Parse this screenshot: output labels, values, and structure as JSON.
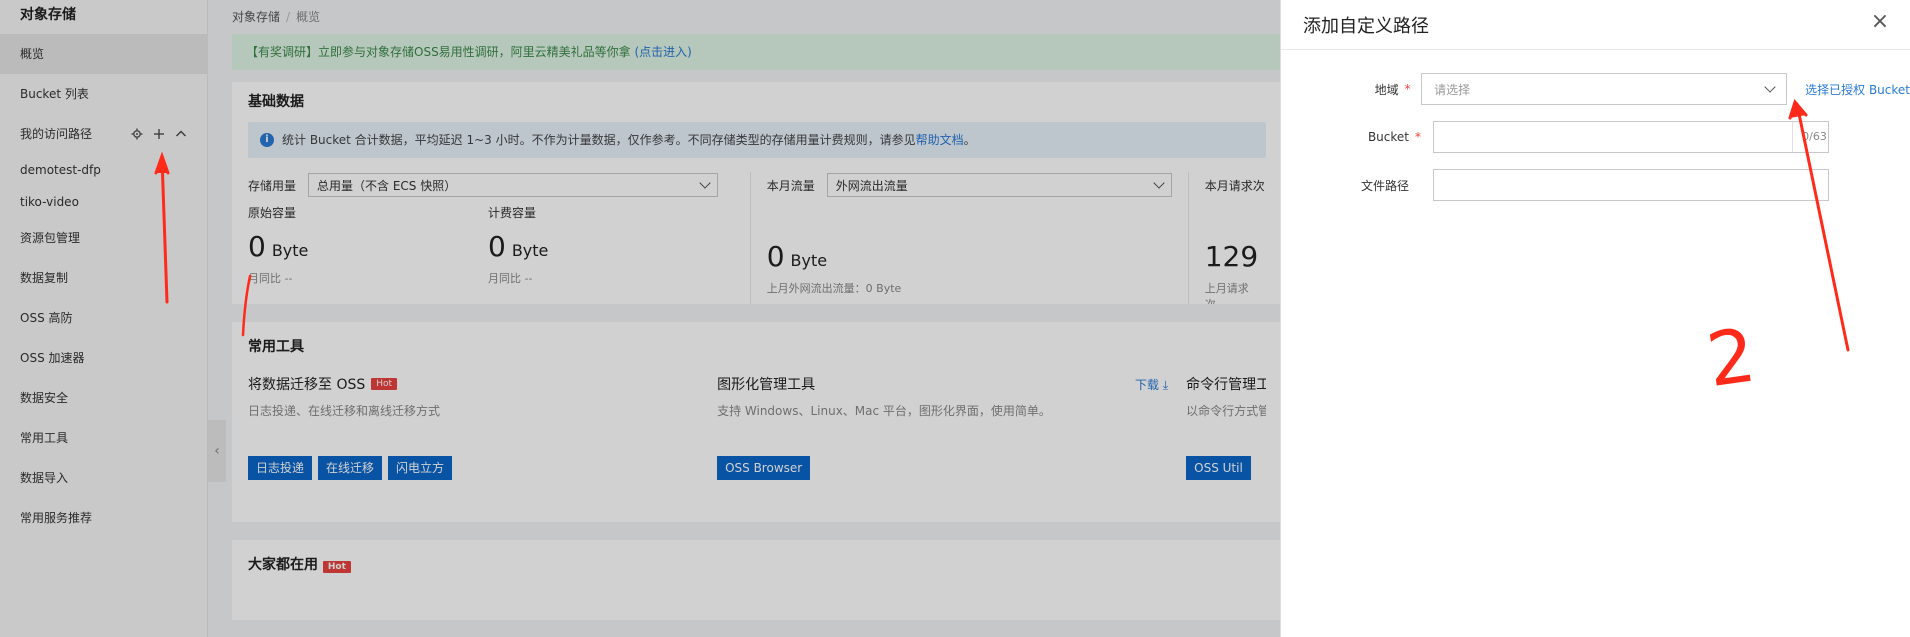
{
  "sidebar": {
    "title": "对象存储",
    "items": [
      {
        "label": "概览",
        "active": true
      },
      {
        "label": "Bucket 列表"
      }
    ],
    "group": {
      "label": "我的访问路径",
      "children": [
        "demotest-dfp",
        "tiko-video"
      ]
    },
    "more_items": [
      "资源包管理",
      "数据复制",
      "OSS 高防",
      "OSS 加速器",
      "数据安全",
      "常用工具",
      "数据导入",
      "常用服务推荐"
    ],
    "collapse_icon": "‹"
  },
  "breadcrumb": {
    "root": "对象存储",
    "sep": "/",
    "current": "概览"
  },
  "notice": {
    "text": "【有奖调研】立即参与对象存储OSS易用性调研，阿里云精美礼品等你拿 ",
    "link": "(点击进入)"
  },
  "basic": {
    "title": "基础数据",
    "info_prefix": "统计 Bucket 合计数据，平均延迟 1~3 小时。不作为计量数据，仅作参考。不同存储类型的存储用量计费规则，请参见",
    "info_link": "帮助文档",
    "info_suffix": "。",
    "storage": {
      "label": "存储用量",
      "select": "总用量（不含 ECS 快照）",
      "raw_label": "原始容量",
      "raw_value": "0",
      "raw_unit": "Byte",
      "raw_yoy": "月同比 --",
      "bill_label": "计费容量",
      "bill_value": "0",
      "bill_unit": "Byte",
      "bill_yoy": "月同比 --"
    },
    "traffic": {
      "label": "本月流量",
      "select": "外网流出流量",
      "value": "0",
      "unit": "Byte",
      "last": "上月外网流出流量：0 Byte"
    },
    "requests": {
      "label": "本月请求次",
      "value": "129",
      "last": "上月请求次"
    }
  },
  "tools": {
    "title": "常用工具",
    "hot": "Hot",
    "items": [
      {
        "name": "将数据迁移至 OSS",
        "desc": "日志投递、在线迁移和离线迁移方式",
        "buttons": [
          "日志投递",
          "在线迁移",
          "闪电立方"
        ]
      },
      {
        "name": "图形化管理工具",
        "desc": "支持 Windows、Linux、Mac 平台，图形化界面，使用简单。",
        "download": "下载",
        "buttons": [
          "OSS Browser"
        ]
      },
      {
        "name": "命令行管理工",
        "desc": "以命令行方式管",
        "buttons": [
          "OSS Util"
        ]
      }
    ]
  },
  "popular": {
    "title": "大家都在用",
    "hot": "Hot"
  },
  "drawer": {
    "title": "添加自定义路径",
    "close": "×",
    "region": {
      "label": "地域",
      "placeholder": "请选择",
      "link": "选择已授权 Bucket"
    },
    "bucket": {
      "label": "Bucket",
      "counter": "0/63"
    },
    "path": {
      "label": "文件路径"
    },
    "required_mark": "*"
  },
  "annotation": {
    "number": "2",
    "color": "#ff2a1a"
  }
}
